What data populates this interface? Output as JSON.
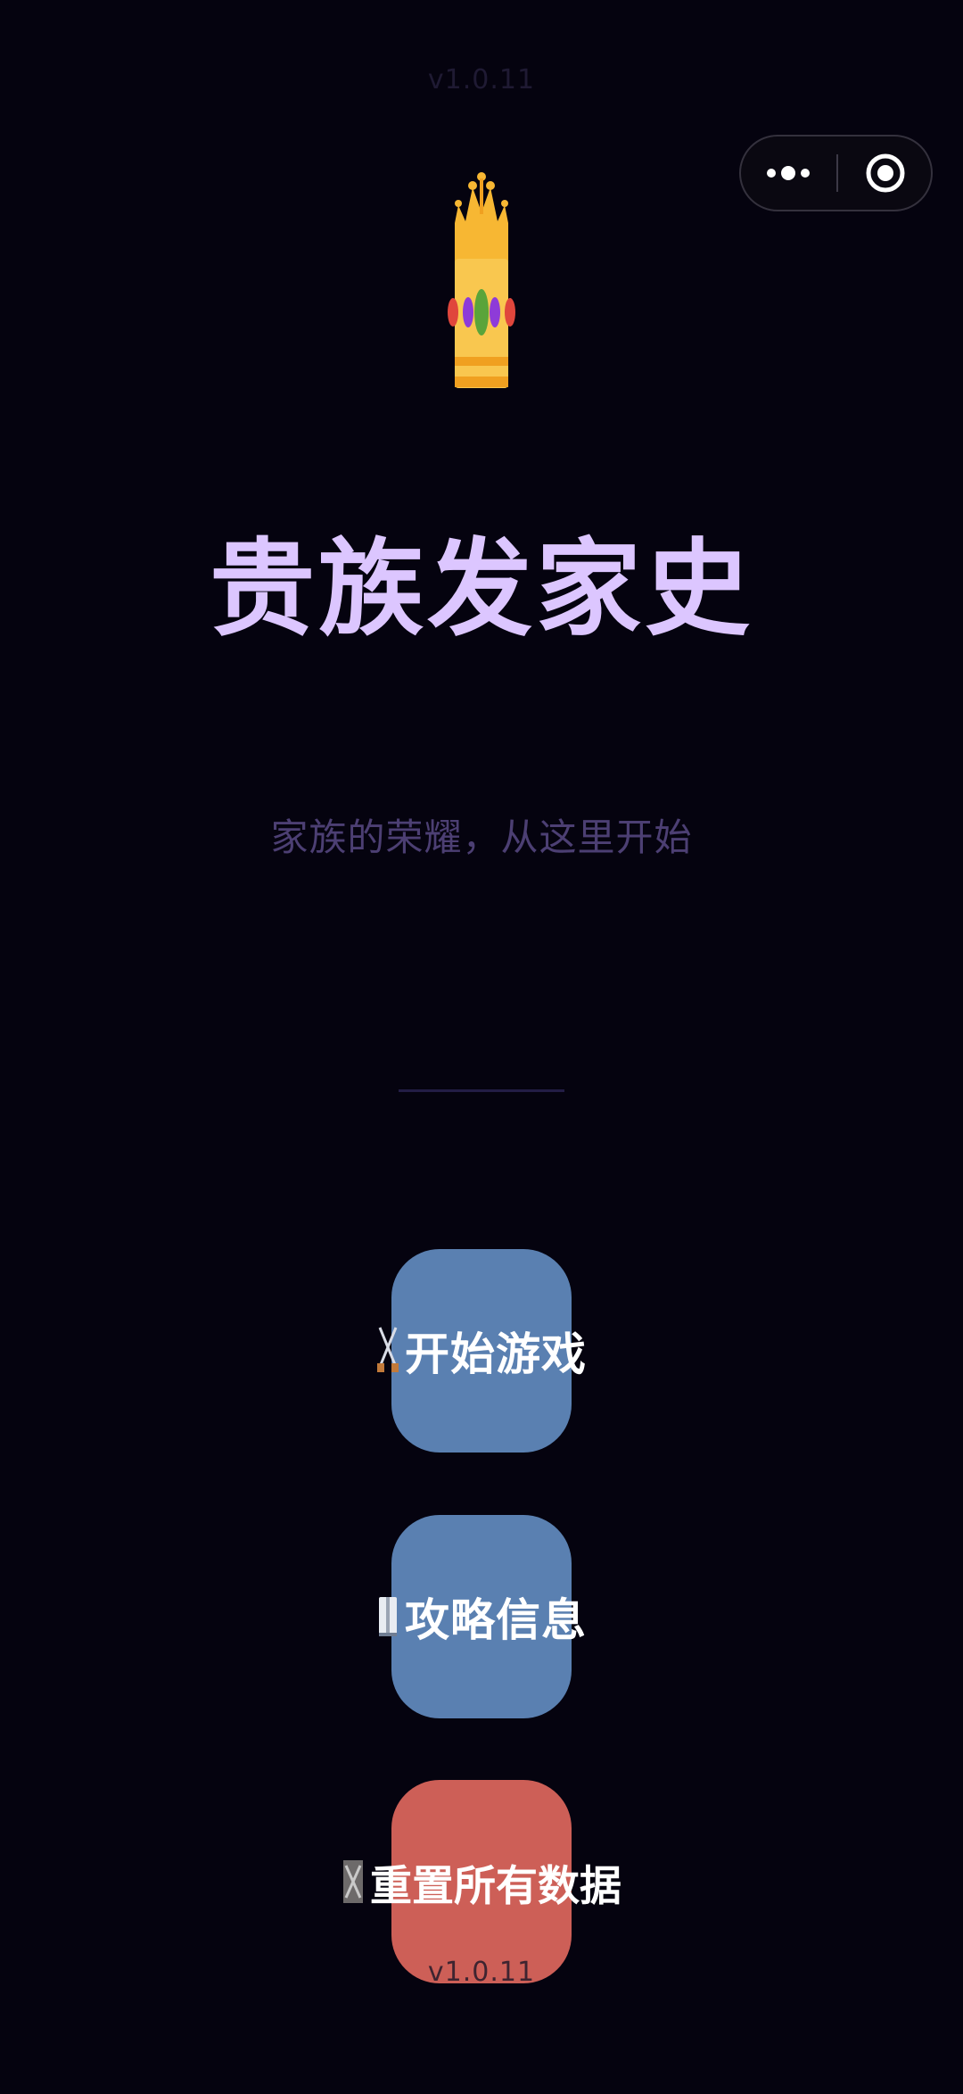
{
  "version": {
    "top": "v1.0.11",
    "bottom": "v1.0.11"
  },
  "header": {
    "capsule_icons": [
      "more-dots-icon",
      "close-target-icon"
    ]
  },
  "hero": {
    "icon": "crown-icon",
    "title": "贵族发家史",
    "subtitle": "家族的荣耀，从这里开始"
  },
  "menu": {
    "start": {
      "icon": "crossed-swords-icon",
      "label": "开始游戏"
    },
    "guide": {
      "icon": "book-icon",
      "label": "攻略信息"
    },
    "reset": {
      "icon": "reset-icon",
      "label": "重置所有数据"
    }
  },
  "colors": {
    "background": "#05030f",
    "title": "#dcc6ff",
    "subtitle": "#4c3f73",
    "primary_button": "#5a80b1",
    "danger_button": "#cd5f57",
    "crown": "#f5b93d"
  }
}
